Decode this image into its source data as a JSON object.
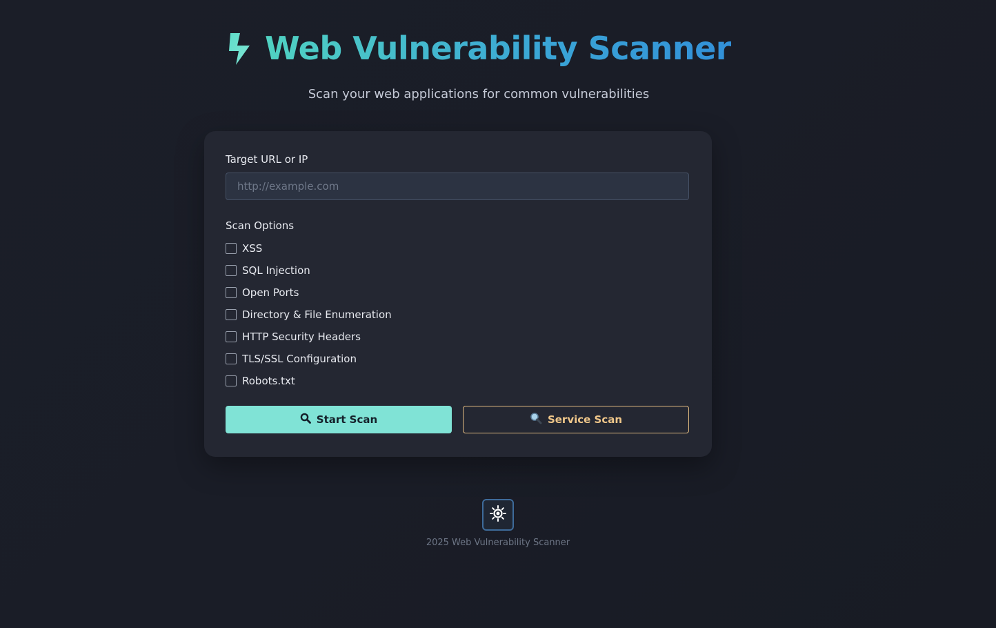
{
  "header": {
    "icon": "lightning-bolt-icon",
    "title": "Web Vulnerability Scanner",
    "subtitle": "Scan your web applications for common vulnerabilities"
  },
  "form": {
    "url_label": "Target URL or IP",
    "url_value": "",
    "url_placeholder": "http://example.com",
    "options_label": "Scan Options",
    "options": [
      {
        "label": "XSS",
        "checked": false
      },
      {
        "label": "SQL Injection",
        "checked": false
      },
      {
        "label": "Open Ports",
        "checked": false
      },
      {
        "label": "Directory & File Enumeration",
        "checked": false
      },
      {
        "label": "HTTP Security Headers",
        "checked": false
      },
      {
        "label": "TLS/SSL Configuration",
        "checked": false
      },
      {
        "label": "Robots.txt",
        "checked": false
      }
    ],
    "start_scan_label": "Start Scan",
    "service_scan_label": "Service Scan"
  },
  "footer": {
    "theme_toggle_icon": "sun-icon",
    "text": "2025 Web Vulnerability Scanner"
  },
  "colors": {
    "accent": "#80e3d6",
    "title_gradient_start": "#50d2c2",
    "title_gradient_end": "#3290d8",
    "secondary_accent": "#f0c78a",
    "background": "#1b1e28",
    "card": "#242732"
  }
}
